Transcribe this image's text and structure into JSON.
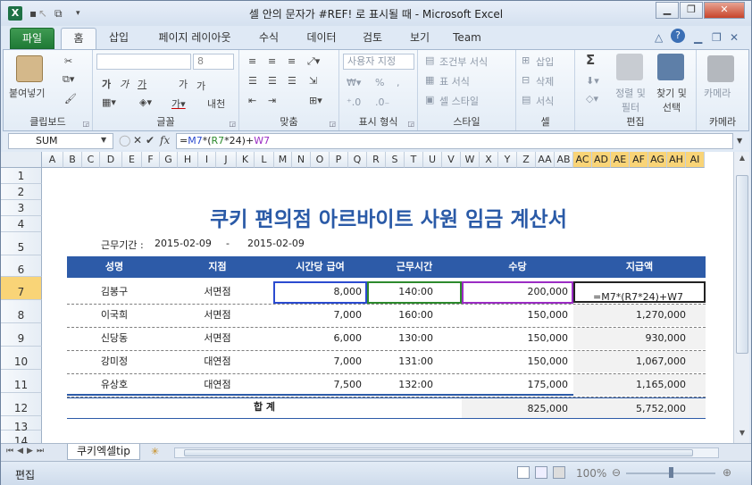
{
  "title_bar": {
    "title": "셀 안의 문자가 #REF! 로 표시될 때  -  Microsoft Excel",
    "minimize": "▁",
    "restore": "❐",
    "close": "✕"
  },
  "tabs": [
    "파일",
    "홈",
    "삽입",
    "페이지 레이아웃",
    "수식",
    "데이터",
    "검토",
    "보기",
    "Team"
  ],
  "ribbon": {
    "clipboard": {
      "paste": "붙여넣기",
      "label": "클립보드"
    },
    "font": {
      "font_size": "8",
      "bold": "가",
      "italic": "가",
      "underline": "가",
      "grow": "가",
      "shrink": "가",
      "pattern": "내천",
      "label": "글꼴"
    },
    "alignment": {
      "label": "맞춤"
    },
    "number": {
      "format": "사용자 지정",
      "percent": "%",
      "label": "표시 형식"
    },
    "styles": {
      "conditional": "조건부 서식",
      "table": "표 서식",
      "cell": "셀 스타일",
      "label": "스타일"
    },
    "cells": {
      "insert": "삽입",
      "delete": "삭제",
      "format": "서식",
      "label": "셀"
    },
    "editing": {
      "sum": "Σ",
      "sort": "정렬 및 필터",
      "find": "찾기 및 선택",
      "label": "편집"
    },
    "camera": {
      "name": "카메라",
      "label": "카메라"
    }
  },
  "formula_bar": {
    "name_box": "SUM",
    "fx": "fx",
    "formula_parts": [
      {
        "text": "=",
        "color": "#222222"
      },
      {
        "text": "M7",
        "color": "#2b4bd0"
      },
      {
        "text": "*(",
        "color": "#222222"
      },
      {
        "text": "R7",
        "color": "#2d8a2d"
      },
      {
        "text": "*24)+",
        "color": "#222222"
      },
      {
        "text": "W7",
        "color": "#9b2cc4"
      }
    ]
  },
  "columns": [
    "A",
    "B",
    "C",
    "D",
    "E",
    "F",
    "G",
    "H",
    "I",
    "J",
    "K",
    "L",
    "M",
    "N",
    "O",
    "P",
    "Q",
    "R",
    "S",
    "T",
    "U",
    "V",
    "W",
    "X",
    "Y",
    "Z",
    "AA",
    "AB",
    "AC",
    "AD",
    "AE",
    "AF",
    "AG",
    "AH",
    "AI"
  ],
  "rows": [
    "1",
    "2",
    "3",
    "4",
    "5",
    "6",
    "7",
    "8",
    "9",
    "10",
    "11",
    "12",
    "13",
    "14"
  ],
  "sheet": {
    "title": "쿠키 편의점 아르바이트 사원 임금 계산서",
    "period_label": "근무기간 :",
    "period_start": "2015-02-09",
    "period_dash": "-",
    "period_end": "2015-02-09",
    "headers": [
      "성명",
      "지점",
      "시간당 급여",
      "근무시간",
      "수당",
      "지급액"
    ],
    "data_rows": [
      {
        "name": "김봉구",
        "branch": "서면점",
        "rate": "8,000",
        "hours": "140:00",
        "bonus": "200,000",
        "pay": "=M7*(R7*24)+W7"
      },
      {
        "name": "이국희",
        "branch": "서면점",
        "rate": "7,000",
        "hours": "160:00",
        "bonus": "150,000",
        "pay": "1,270,000"
      },
      {
        "name": "신당동",
        "branch": "서면점",
        "rate": "6,000",
        "hours": "130:00",
        "bonus": "150,000",
        "pay": "930,000"
      },
      {
        "name": "강미정",
        "branch": "대연점",
        "rate": "7,000",
        "hours": "131:00",
        "bonus": "150,000",
        "pay": "1,067,000"
      },
      {
        "name": "유상호",
        "branch": "대연점",
        "rate": "7,500",
        "hours": "132:00",
        "bonus": "175,000",
        "pay": "1,165,000"
      }
    ],
    "total_label": "합  계",
    "total_bonus": "825,000",
    "total_pay": "5,752,000"
  },
  "sheet_tab": "쿠키엑셀tip",
  "status": {
    "mode": "편집",
    "zoom": "100%"
  },
  "colors": {
    "header_blue": "#2d5ba8",
    "title_blue": "#2a5aa7",
    "file_green": "#1f7a36"
  }
}
